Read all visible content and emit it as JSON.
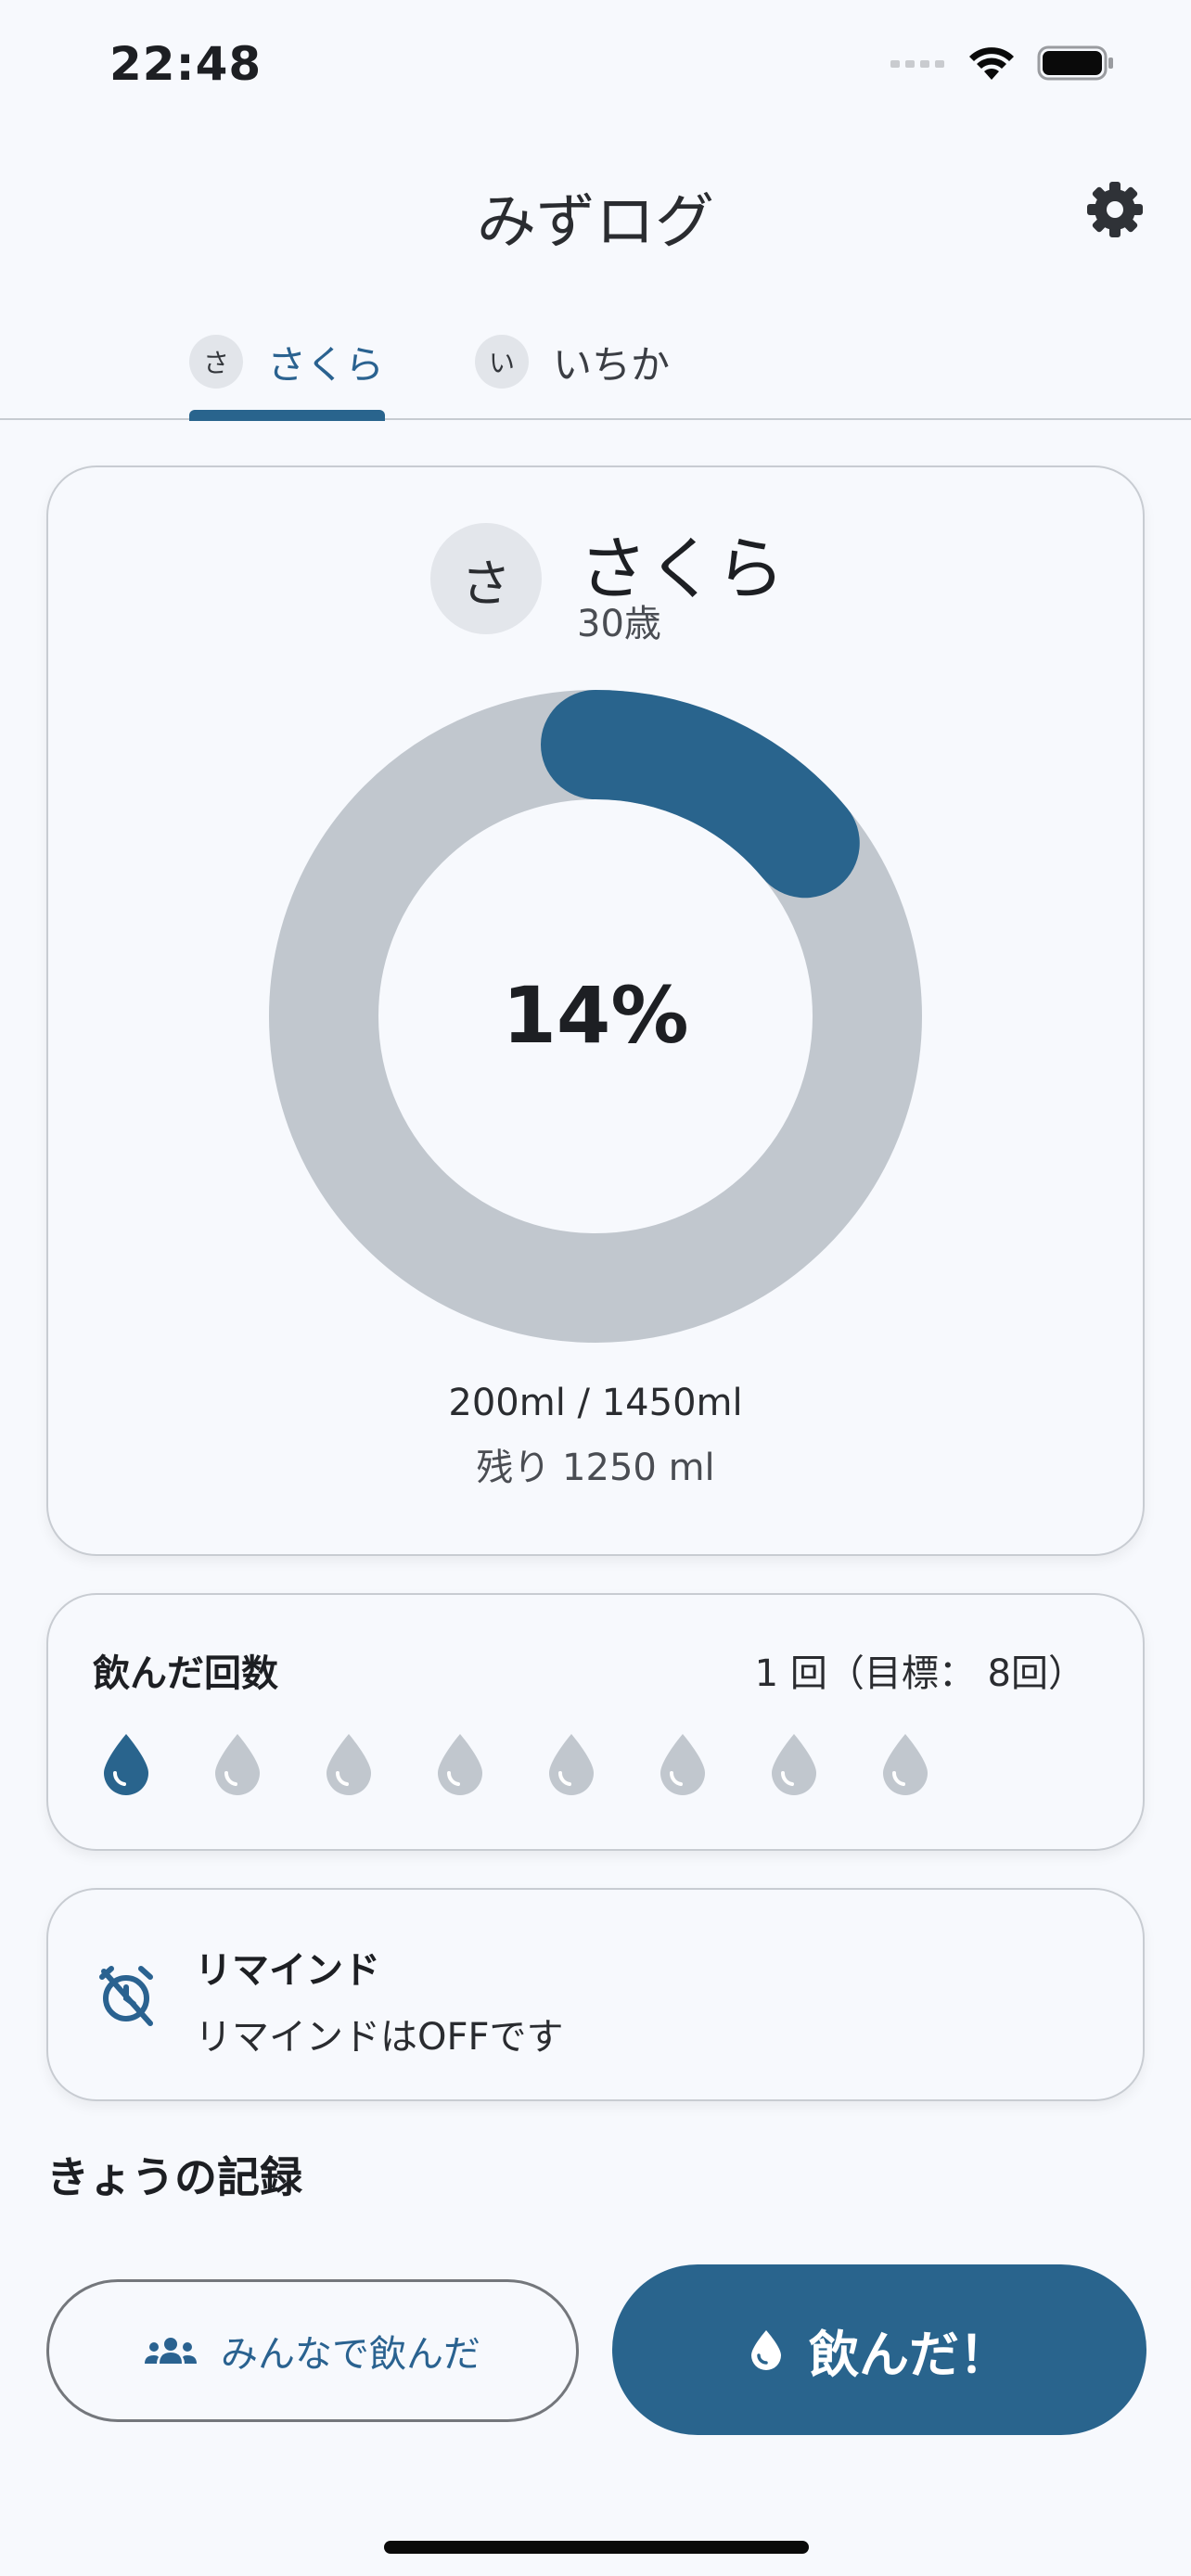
{
  "status_bar": {
    "time": "22:48"
  },
  "header": {
    "title": "みずログ",
    "settings_icon": "gear-icon"
  },
  "tabs": [
    {
      "initial": "さ",
      "label": "さくら",
      "active": true
    },
    {
      "initial": "い",
      "label": "いちか",
      "active": false
    }
  ],
  "profile": {
    "initial": "さ",
    "name": "さくら",
    "age": "30歳"
  },
  "progress": {
    "percent_label": "14%",
    "fraction": 0.14,
    "amount": "200ml / 1450ml",
    "remaining": "残り 1250 ml"
  },
  "count": {
    "title": "飲んだ回数",
    "value": "1 回（目標： 8回）",
    "done": 1,
    "goal": 8
  },
  "reminder": {
    "title": "リマインド",
    "status": "リマインドはOFFです",
    "icon": "alarm-off-icon"
  },
  "records": {
    "heading": "きょうの記録"
  },
  "actions": {
    "group_label": "みんなで飲んだ",
    "group_icon": "people-icon",
    "drink_label": "飲んだ！",
    "drink_icon": "water-drop-icon"
  },
  "colors": {
    "accent": "#29648d",
    "track": "#c1c7ce",
    "drop_inactive": "#c1c7ce",
    "background": "#f7f9fd"
  }
}
